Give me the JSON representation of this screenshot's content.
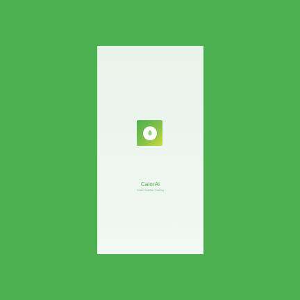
{
  "app": {
    "name": "CalorAi",
    "tagline": "Smart Healthier Tracking"
  },
  "icons": {
    "logo": "leaf-icon"
  },
  "colors": {
    "background": "#4caf50",
    "brand": "#4caf50",
    "icon_gradient_start": "#4caf50",
    "icon_gradient_end": "#cddc39"
  }
}
